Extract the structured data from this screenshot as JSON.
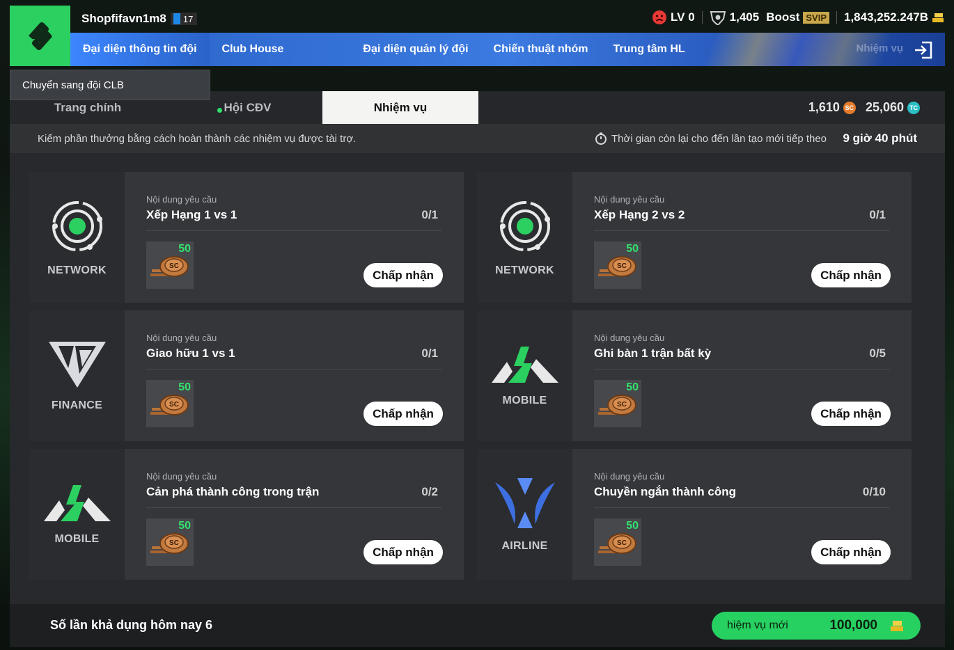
{
  "user": {
    "name": "Shopfifavn1m8",
    "level": "17"
  },
  "top_stats": {
    "lv": "LV 0",
    "points": "1,405",
    "boost_label": "Boost",
    "svip_label": "SVIP",
    "balance": "1,843,252.247B"
  },
  "nav": {
    "items": [
      {
        "label": "Đại diện thông tin đội"
      },
      {
        "label": "Club House"
      },
      {
        "label": "Đại diện quản lý đội"
      },
      {
        "label": "Chiến thuật nhóm"
      },
      {
        "label": "Trung tâm HL"
      }
    ],
    "ghost_label": "Nhiệm vụ"
  },
  "tooltip": "Chuyển sang đội CLB",
  "tabs": [
    {
      "label": "Trang chính"
    },
    {
      "label": "Hội CĐV"
    },
    {
      "label": "Nhiệm vụ"
    }
  ],
  "currency": {
    "sc": "1,610",
    "sc_icon": "SC",
    "tc": "25,060",
    "tc_icon": "TC"
  },
  "info": {
    "description": "Kiếm phần thưởng bằng cách hoàn thành các nhiệm vụ được tài trợ.",
    "time_label": "Thời gian còn lại cho đến lần tạo mới tiếp theo",
    "time_value": "9 giờ 40 phút"
  },
  "missions": [
    {
      "brand": "NETWORK",
      "req_label": "Nội dung yêu cầu",
      "title": "Xếp Hạng 1 vs 1",
      "progress": "0/1",
      "reward": "50",
      "button": "Chấp nhận"
    },
    {
      "brand": "NETWORK",
      "req_label": "Nội dung yêu cầu",
      "title": "Xếp Hạng 2 vs 2",
      "progress": "0/1",
      "reward": "50",
      "button": "Chấp nhận"
    },
    {
      "brand": "FINANCE",
      "req_label": "Nội dung yêu cầu",
      "title": "Giao hữu 1 vs 1",
      "progress": "0/1",
      "reward": "50",
      "button": "Chấp nhận"
    },
    {
      "brand": "MOBILE",
      "req_label": "Nội dung yêu cầu",
      "title": "Ghi bàn 1 trận bất kỳ",
      "progress": "0/5",
      "reward": "50",
      "button": "Chấp nhận"
    },
    {
      "brand": "MOBILE",
      "req_label": "Nội dung yêu cầu",
      "title": "Cản phá thành công trong trận",
      "progress": "0/2",
      "reward": "50",
      "button": "Chấp nhận"
    },
    {
      "brand": "AIRLINE",
      "req_label": "Nội dung yêu cầu",
      "title": "Chuyền ngắn thành công",
      "progress": "0/10",
      "reward": "50",
      "button": "Chấp nhận"
    }
  ],
  "reward_icon_label": "SC",
  "footer": {
    "available": "Số lần khả dụng hôm nay 6",
    "new_mission_label": "hiệm vụ mới",
    "new_mission_cost": "100,000"
  }
}
